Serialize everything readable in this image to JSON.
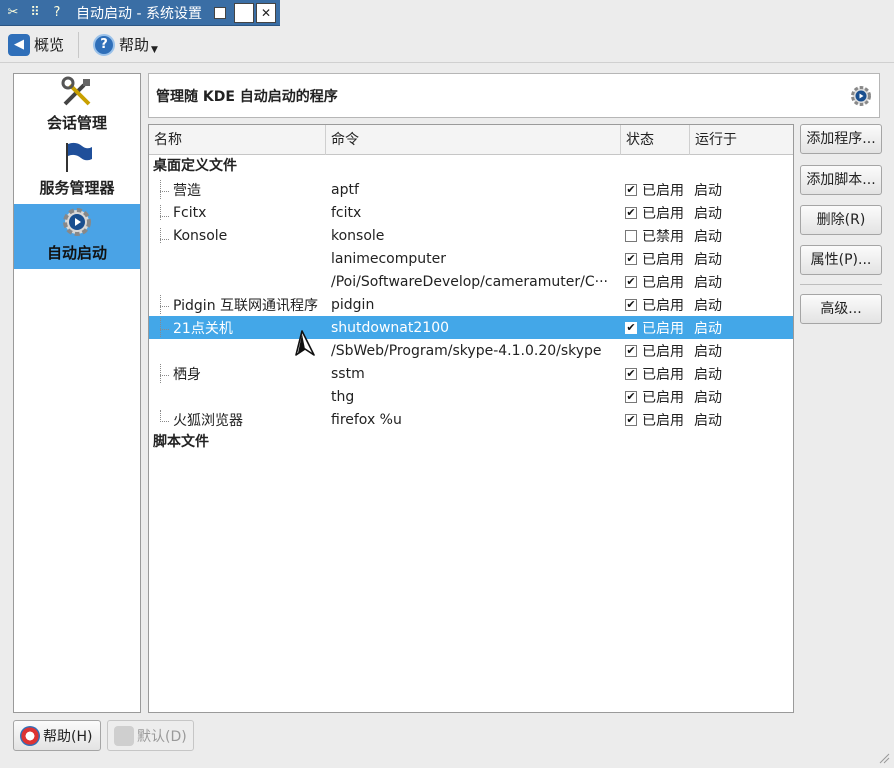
{
  "window": {
    "title": "自动启动 - 系统设置",
    "help_glyph": "?"
  },
  "toolbar": {
    "back_label": "概览",
    "help_label": "帮助"
  },
  "sidebar": {
    "items": [
      {
        "label": "会话管理",
        "icon": "tools-icon"
      },
      {
        "label": "服务管理器",
        "icon": "flag-icon"
      },
      {
        "label": "自动启动",
        "icon": "gear-icon",
        "active": true
      }
    ]
  },
  "header": {
    "title": "管理随 KDE 自动启动的程序"
  },
  "table": {
    "columns": [
      "名称",
      "命令",
      "状态",
      "运行于"
    ],
    "groups": [
      {
        "label": "桌面定义文件",
        "rows": [
          {
            "name": "营造",
            "command": "aptf",
            "checked": true,
            "status": "已启用",
            "run": "启动"
          },
          {
            "name": "Fcitx",
            "command": "fcitx",
            "checked": true,
            "status": "已启用",
            "run": "启动"
          },
          {
            "name": "Konsole",
            "command": "konsole",
            "checked": false,
            "status": "已禁用",
            "run": "启动"
          },
          {
            "name": "",
            "command": "lanimecomputer",
            "checked": true,
            "status": "已启用",
            "run": "启动"
          },
          {
            "name": "",
            "command": "/Poi/SoftwareDevelop/cameramuter/C···",
            "checked": true,
            "status": "已启用",
            "run": "启动"
          },
          {
            "name": "Pidgin 互联网通讯程序",
            "command": "pidgin",
            "checked": true,
            "status": "已启用",
            "run": "启动"
          },
          {
            "name": "21点关机",
            "command": "shutdownat2100",
            "checked": true,
            "status": "已启用",
            "run": "启动",
            "selected": true
          },
          {
            "name": "",
            "command": "/SbWeb/Program/skype-4.1.0.20/skype",
            "checked": true,
            "status": "已启用",
            "run": "启动"
          },
          {
            "name": "栖身",
            "command": "sstm",
            "checked": true,
            "status": "已启用",
            "run": "启动"
          },
          {
            "name": "",
            "command": "thg",
            "checked": true,
            "status": "已启用",
            "run": "启动"
          },
          {
            "name": "火狐浏览器",
            "command": "firefox %u",
            "checked": true,
            "status": "已启用",
            "run": "启动"
          }
        ]
      },
      {
        "label": "脚本文件",
        "rows": []
      }
    ]
  },
  "buttons": {
    "add_program": "添加程序...",
    "add_script": "添加脚本...",
    "remove": "删除(R)",
    "properties": "属性(P)...",
    "advanced": "高级...",
    "help": "帮助(H)",
    "default": "默认(D)"
  },
  "colors": {
    "selection": "#43a7e8",
    "sidebar_active": "#4aa3e6",
    "titlebar": "#3a6ea5"
  }
}
